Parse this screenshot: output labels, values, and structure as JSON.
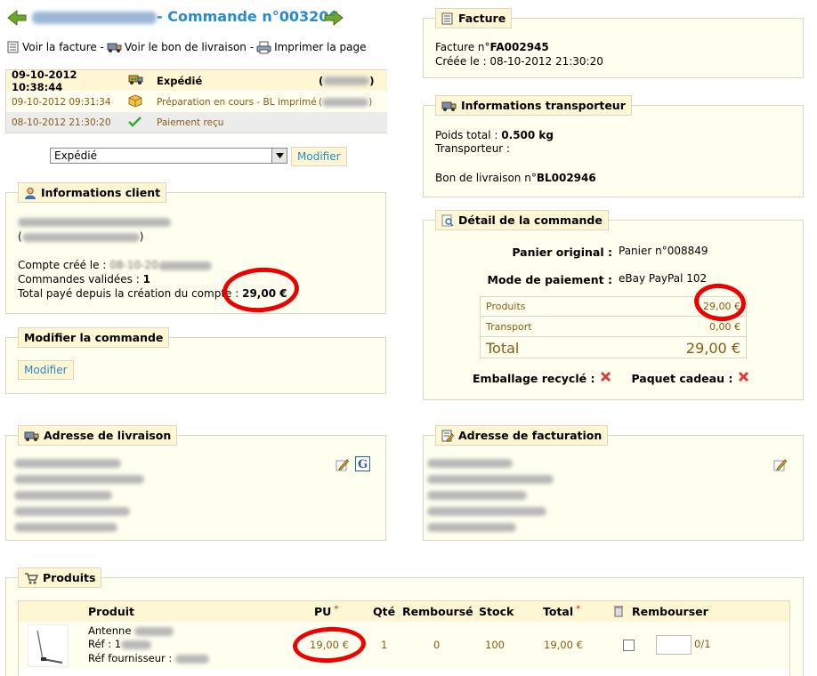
{
  "header": {
    "title": "- Commande n°003206",
    "links": {
      "invoice": "Voir la facture -",
      "delivery": "Voir le bon de livraison -",
      "print": "Imprimer la page"
    }
  },
  "history": [
    {
      "date": "09-10-2012 10:38:44",
      "status": "Expédié",
      "icon": "truck-arrow-icon",
      "color": "#000000"
    },
    {
      "date": "09-10-2012 09:31:34",
      "status": "Préparation en cours - BL imprimé",
      "icon": "box-icon",
      "color": "#8a5a12"
    },
    {
      "date": "08-10-2012 21:30:20",
      "status": "Paiement reçu",
      "icon": "check-icon",
      "color": "#8a5a12"
    }
  ],
  "status_select": {
    "value": "Expédié",
    "button": "Modifier"
  },
  "client": {
    "legend": "Informations client",
    "created_label": "Compte créé le :",
    "created_value": "08-10-20",
    "validated_label": "Commandes validées :",
    "validated_value": "1",
    "total_label": "Total payé depuis la création du compte :",
    "total_value": "29,00 €"
  },
  "modify_order": {
    "legend": "Modifier la commande",
    "button": "Modifier"
  },
  "invoice": {
    "legend": "Facture",
    "number_label": "Facture n°",
    "number_value": "FA002945",
    "created": "Créée le : 08-10-2012 21:30:20"
  },
  "carrier": {
    "legend": "Informations transporteur",
    "weight_label": "Poids total :",
    "weight_value": "0.500 kg",
    "carrier_label": "Transporteur :",
    "delivery_label": "Bon de livraison n°",
    "delivery_value": "BL002946"
  },
  "detail": {
    "legend": "Détail de la commande",
    "cart_label": "Panier original :",
    "cart_value": "Panier n°008849",
    "payment_label": "Mode de paiement :",
    "payment_value": "eBay PayPal 102",
    "products_label": "Produits",
    "products_value": "29,00 €",
    "shipping_label": "Transport",
    "shipping_value": "0,00 €",
    "total_label": "Total",
    "total_value": "29,00 €",
    "recycled_label": "Emballage recyclé :",
    "gift_label": "Paquet cadeau :"
  },
  "delivery_address": {
    "legend": "Adresse de livraison"
  },
  "billing_address": {
    "legend": "Adresse de facturation"
  },
  "products": {
    "legend": "Produits",
    "columns": {
      "product": "Produit",
      "pu": "PU",
      "qty": "Qté",
      "refunded": "Remboursé",
      "stock": "Stock",
      "total": "Total",
      "refund": "Rembourser"
    },
    "rows": [
      {
        "name": "Antenne",
        "ref": "Réf : 1",
        "supplier_ref": "Réf fournisseur :",
        "pu": "19,00 €",
        "qty": "1",
        "refunded": "0",
        "stock": "100",
        "total": "19,00 €",
        "refund_count": "0/1"
      }
    ]
  },
  "colors": {
    "accent": "#268ccd",
    "legend_bg": "#fff6d3",
    "fieldset_bg": "#fffff0",
    "border": "#dfd5c3",
    "highlight": "#ee0000"
  }
}
